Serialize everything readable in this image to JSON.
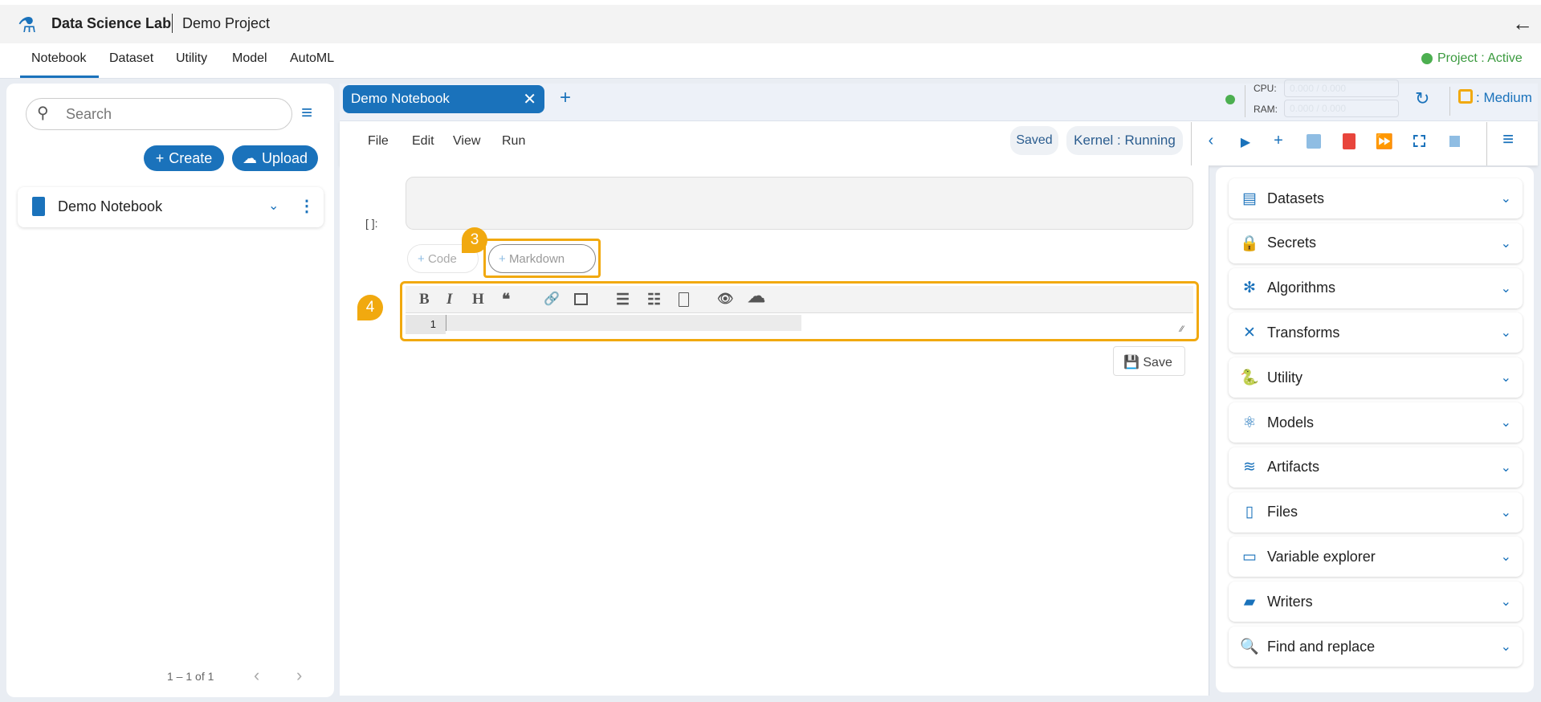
{
  "header": {
    "app_title": "Data Science Lab",
    "project": "Demo Project",
    "back_icon": "arrow-left-icon"
  },
  "nav": {
    "tabs": [
      "Notebook",
      "Dataset",
      "Utility",
      "Model",
      "AutoML"
    ],
    "active": "Notebook",
    "project_status": "Project : Active",
    "status_color": "#4caf50"
  },
  "sidebar": {
    "search_placeholder": "Search",
    "create_label": "Create",
    "upload_label": "Upload",
    "items": [
      {
        "name": "Demo Notebook"
      }
    ],
    "pagination": "1 – 1 of 1"
  },
  "notebook": {
    "tab_label": "Demo Notebook",
    "cpu_label": "CPU:",
    "ram_label": "RAM:",
    "cpu_value": "0.000 / 0.000",
    "ram_value": "0.000 / 0.000",
    "compute": ": Medium",
    "menu": [
      "File",
      "Edit",
      "View",
      "Run"
    ],
    "saved": "Saved",
    "kernel": "Kernel : Running",
    "cell_prompt": "[ ]:",
    "add_code": "Code",
    "add_markdown": "Markdown",
    "line_number": "1",
    "save_label": "Save",
    "badges": [
      "3",
      "4"
    ],
    "accent": "#1a72bb",
    "highlight": "#f1a90f"
  },
  "right_panel": {
    "items": [
      "Datasets",
      "Secrets",
      "Algorithms",
      "Transforms",
      "Utility",
      "Models",
      "Artifacts",
      "Files",
      "Variable explorer",
      "Writers",
      "Find and replace"
    ]
  }
}
